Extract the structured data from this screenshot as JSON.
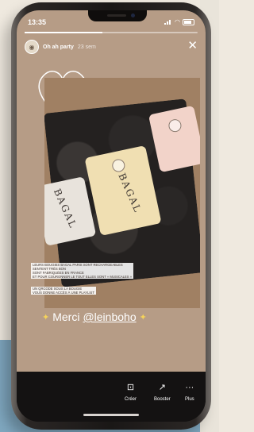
{
  "status": {
    "time": "13:35"
  },
  "story": {
    "account_name": "Oh ah party",
    "time_ago": "23 sem",
    "tagged_account": "leinboho",
    "progress_fraction": 0.45
  },
  "caption_lines": [
    "LEURS BOUGIES BAGAL PARIS SONT RECHARGEABLES",
    "SENTENT TRÈS BON",
    "SONT FABRIQUÉES EN FRANCE",
    "ET POUR COURONNER LE TOUT ELLES SONT « MUSICALES »",
    "UN QRCODE SOUS LA BOUGIE",
    "VOUS DONNE ACCÈS À UNE PLAYLIST"
  ],
  "candle_brand": "BAGAL",
  "thanks": {
    "text": "Merci",
    "mention": "@leinboho"
  },
  "actions": [
    {
      "icon": "create-icon",
      "label": "Créer",
      "glyph": "⊡"
    },
    {
      "icon": "boost-icon",
      "label": "Booster",
      "glyph": "↗"
    },
    {
      "icon": "more-icon",
      "label": "Plus",
      "glyph": "···"
    }
  ],
  "colors": {
    "accent_sparkle": "#f5d35a",
    "bar": "#141212"
  }
}
